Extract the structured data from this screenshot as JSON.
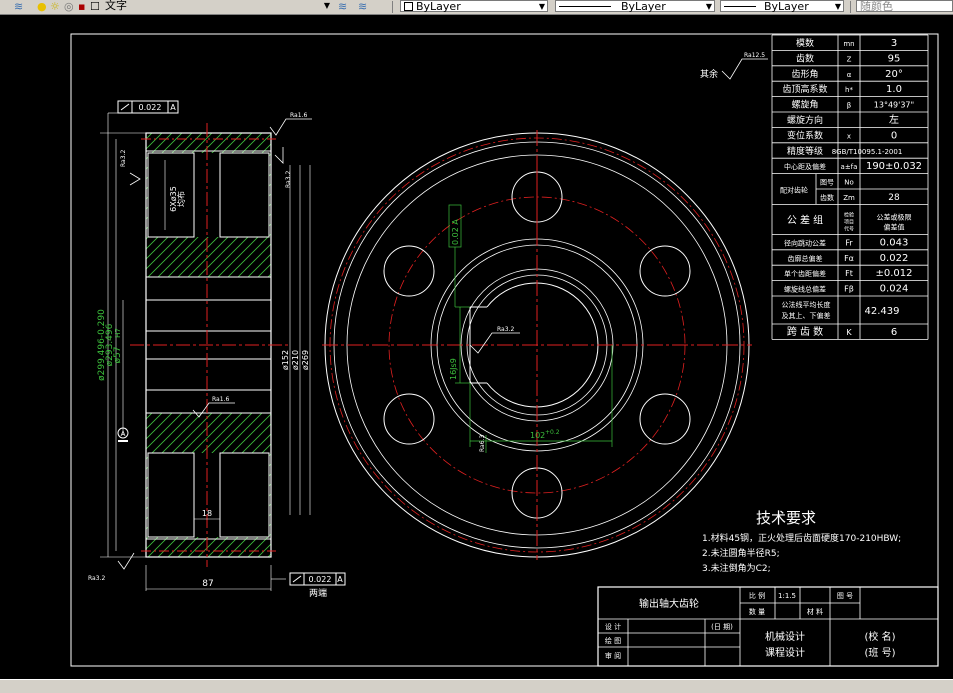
{
  "toolbar": {
    "text_style": "文字",
    "color_select": "ByLayer",
    "linetype_select": "ByLayer",
    "lineweight_select": "ByLayer",
    "plot_style": "随颜色"
  },
  "drawing": {
    "surface_note": "其余",
    "roughness_rest": "Ra12.5",
    "tol_flat_top": "0.022",
    "tol_flat_bottom": "0.022",
    "datum": "A",
    "ra_top_right": "Ra1.6",
    "ra_top_left": "Ra3.2",
    "ra_right_hub": "Ra3.2",
    "ra_mid": "Ra1.6",
    "ra_bottom": "Ra3.2",
    "ra_center": "Ra3.2",
    "ra_keyway": "Ra6.3",
    "dim_hole": "6Xø35",
    "dim_hole_sub": "均布",
    "dim_od": "ø299.496-0.290",
    "dim_pitch": "ø293.496",
    "dim_bore": "ø57",
    "dim_bore_tol": "H7",
    "dim_d152": "ø152",
    "dim_d210": "ø210",
    "dim_d269": "ø269",
    "dim_width": "87",
    "dim_web": "18",
    "note_both": "两端",
    "dim_keyway_width": "16Js9",
    "dim_keyway_depth": "102",
    "dim_keyway_depth_tol": "+0.2",
    "dim_keyway_vert": "0.02 A"
  },
  "params": [
    {
      "name": "模数",
      "sym": "mn",
      "val": "3"
    },
    {
      "name": "齿数",
      "sym": "Z",
      "val": "95"
    },
    {
      "name": "齿形角",
      "sym": "α",
      "val": "20°"
    },
    {
      "name": "齿顶高系数",
      "sym": "h*",
      "val": "1.0"
    },
    {
      "name": "螺旋角",
      "sym": "β",
      "val": "13°49'37\""
    },
    {
      "name": "螺旋方向",
      "sym": "",
      "val": "左"
    },
    {
      "name": "变位系数",
      "sym": "x",
      "val": "0"
    },
    {
      "name": "精度等级",
      "sym": "",
      "val": "8GB/T10095.1-2001"
    },
    {
      "name": "中心距及偏差",
      "sym": "a±fa",
      "val": "190±0.032"
    }
  ],
  "pair": {
    "label": "配对齿轮",
    "r1_name": "图号",
    "r1_sym": "No",
    "r1_val": "",
    "r2_name": "齿数",
    "r2_sym": "Zm",
    "r2_val": "28"
  },
  "tol_group": {
    "label": "公 差 组",
    "col2": "检验项目代号",
    "col3": "公差或极限偏差值"
  },
  "tol_rows": [
    {
      "name": "径向跳动公差",
      "sym": "Fr",
      "val": "0.043"
    },
    {
      "name": "齿廓总偏差",
      "sym": "Fα",
      "val": "0.022"
    },
    {
      "name": "单个齿距偏差",
      "sym": "Ft",
      "val": "±0.012"
    },
    {
      "name": "螺旋线总偏差",
      "sym": "Fβ",
      "val": "0.024"
    }
  ],
  "wkn": {
    "label1": "公法线平均长度",
    "label2": "及其上、下偏差",
    "val": "42.439"
  },
  "span": {
    "name": "跨 齿 数",
    "sym": "K",
    "val": "6"
  },
  "requirements": {
    "title": "技术要求",
    "items": [
      "1.材料45钢，正火处理后齿面硬度170-210HBW;",
      "2.未注圆角半径R5;",
      "3.未注倒角为C2;"
    ]
  },
  "title_block": {
    "part_name": "输出轴大齿轮",
    "scale_label": "比 例",
    "scale_val": "1:1.5",
    "drawing_no_label": "图 号",
    "qty_label": "数 量",
    "material_label": "材 料",
    "design_label": "设 计",
    "date_label": "(日 期)",
    "draw_label": "绘 图",
    "review_label": "审 阅",
    "course1": "机械设计",
    "course2": "课程设计",
    "school": "(校  名)",
    "class": "(班  号)"
  }
}
